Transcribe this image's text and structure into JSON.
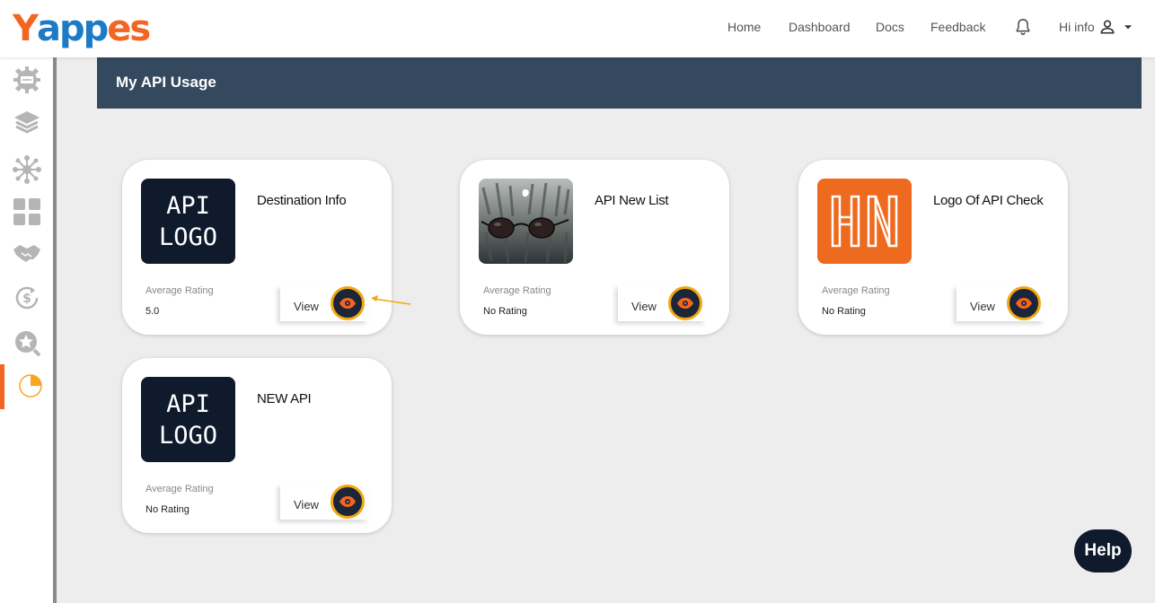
{
  "brand": {
    "logo_text_y": "Y",
    "logo_text_mid": "app",
    "logo_text_end": "es",
    "colors": {
      "orange": "#f26522",
      "blue": "#1d7ac7",
      "navy": "#0f1b2d",
      "header": "#34495e",
      "eye_ring": "#f2a712"
    }
  },
  "nav": {
    "home": "Home",
    "dashboard": "Dashboard",
    "docs": "Docs",
    "feedback": "Feedback",
    "user_greeting": "Hi info",
    "icons": [
      "bell-icon",
      "user-icon",
      "caret-down-icon"
    ]
  },
  "sidebar": {
    "items": [
      {
        "name": "api-settings",
        "icon": "gear-api-icon",
        "active": false
      },
      {
        "name": "layers",
        "icon": "layers-icon",
        "active": false
      },
      {
        "name": "network",
        "icon": "network-icon",
        "active": false
      },
      {
        "name": "grid",
        "icon": "grid-icon",
        "active": false
      },
      {
        "name": "handshake",
        "icon": "handshake-icon",
        "active": false
      },
      {
        "name": "billing",
        "icon": "refresh-dollar-icon",
        "active": false
      },
      {
        "name": "reviews",
        "icon": "star-search-icon",
        "active": false
      },
      {
        "name": "usage",
        "icon": "pie-chart-icon",
        "active": true
      }
    ]
  },
  "page": {
    "title": "My API Usage"
  },
  "cards": [
    {
      "name": "Destination Info",
      "thumb": "API LOGO",
      "rating_label": "Average Rating",
      "rating": "5.0",
      "view_label": "View"
    },
    {
      "name": "API New List",
      "thumb": "sunglasses-photo",
      "rating_label": "Average Rating",
      "rating": "No Rating",
      "view_label": "View"
    },
    {
      "name": "Logo Of API Check",
      "thumb": "HN",
      "rating_label": "Average Rating",
      "rating": "No Rating",
      "view_label": "View"
    },
    {
      "name": "NEW API",
      "thumb": "API LOGO",
      "rating_label": "Average Rating",
      "rating": "No Rating",
      "view_label": "View"
    }
  ],
  "thumb_texts": {
    "api_logo_line1": "API",
    "api_logo_line2": "LOGO"
  },
  "help": {
    "label": "Help"
  }
}
